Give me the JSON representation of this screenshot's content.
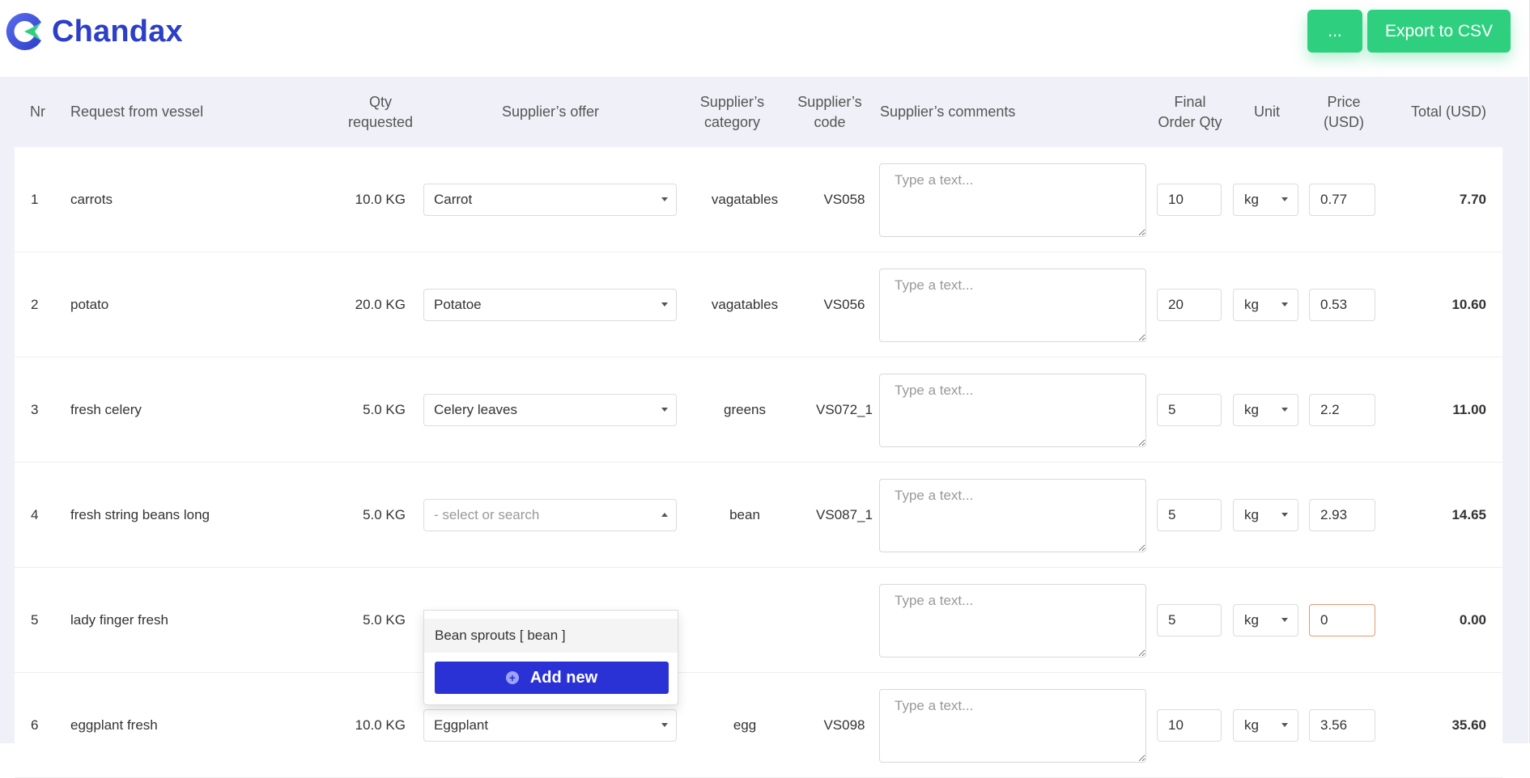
{
  "app": {
    "name": "Chandax"
  },
  "header": {
    "more_label": "...",
    "export_label": "Export to CSV"
  },
  "columns": {
    "nr": "Nr",
    "request": "Request from vessel",
    "qty": "Qty\nrequested",
    "offer": "Supplier’s offer",
    "category": "Supplier’s\ncategory",
    "code": "Supplier’s\ncode",
    "comments": "Supplier’s comments",
    "final_qty": "Final\nOrder Qty",
    "unit": "Unit",
    "price": "Price\n(USD)",
    "total": "Total (USD)"
  },
  "comment_placeholder": "Type a text...",
  "select_placeholder": "- select or search",
  "rows": [
    {
      "nr": "1",
      "request": "carrots",
      "qty": "10.0 KG",
      "offer": "Carrot",
      "category": "vagatables",
      "code": "VS058",
      "final_qty": "10",
      "unit": "kg",
      "price": "0.77",
      "total": "7.70"
    },
    {
      "nr": "2",
      "request": "potato",
      "qty": "20.0 KG",
      "offer": "Potatoe",
      "category": "vagatables",
      "code": "VS056",
      "final_qty": "20",
      "unit": "kg",
      "price": "0.53",
      "total": "10.60"
    },
    {
      "nr": "3",
      "request": "fresh celery",
      "qty": "5.0 KG",
      "offer": "Celery leaves",
      "category": "greens",
      "code": "VS072_1",
      "final_qty": "5",
      "unit": "kg",
      "price": "2.2",
      "total": "11.00"
    },
    {
      "nr": "4",
      "request": "fresh string beans long",
      "qty": "5.0 KG",
      "offer": "",
      "category": "bean",
      "code": "VS087_1",
      "final_qty": "5",
      "unit": "kg",
      "price": "2.93",
      "total": "14.65"
    },
    {
      "nr": "5",
      "request": "lady finger fresh",
      "qty": "5.0 KG",
      "offer": "",
      "category": "",
      "code": "",
      "final_qty": "5",
      "unit": "kg",
      "price": "0",
      "total": "0.00"
    },
    {
      "nr": "6",
      "request": "eggplant fresh",
      "qty": "10.0 KG",
      "offer": "Eggplant",
      "category": "egg",
      "code": "VS098",
      "final_qty": "10",
      "unit": "kg",
      "price": "3.56",
      "total": "35.60"
    }
  ],
  "dropdown": {
    "option": "Bean sprouts [ bean ]",
    "add_label": "Add new"
  },
  "colors": {
    "brand": "#2b3fc7",
    "accent_green": "#2ed07f",
    "add_button": "#2a32d6",
    "warn_border": "#e39a6d"
  }
}
